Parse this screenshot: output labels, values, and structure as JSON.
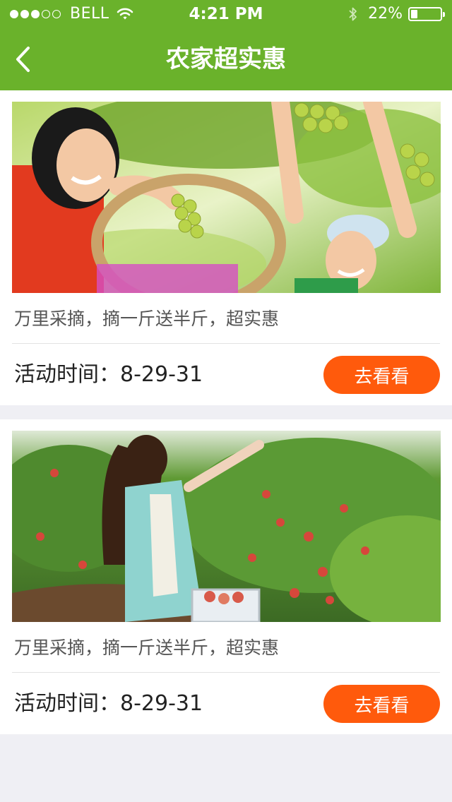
{
  "status_bar": {
    "signal": {
      "filled": 3,
      "total": 5
    },
    "carrier": "BELL",
    "time": "4:21 PM",
    "battery_percent": "22%",
    "battery_level": 0.22
  },
  "nav": {
    "title": "农家超实惠",
    "back_icon": "chevron-left-icon"
  },
  "theme": {
    "header_bg": "#6ab22b",
    "button_bg": "#ff5a0c",
    "page_bg": "#efeff4"
  },
  "cards": [
    {
      "image": "grape-picking-photo",
      "description": "万里采摘，摘一斤送半斤，超实惠",
      "time_label": "活动时间：8-29-31",
      "button_label": "去看看"
    },
    {
      "image": "peach-orchard-photo",
      "description": "万里采摘，摘一斤送半斤，超实惠",
      "time_label": "活动时间：8-29-31",
      "button_label": "去看看"
    }
  ]
}
